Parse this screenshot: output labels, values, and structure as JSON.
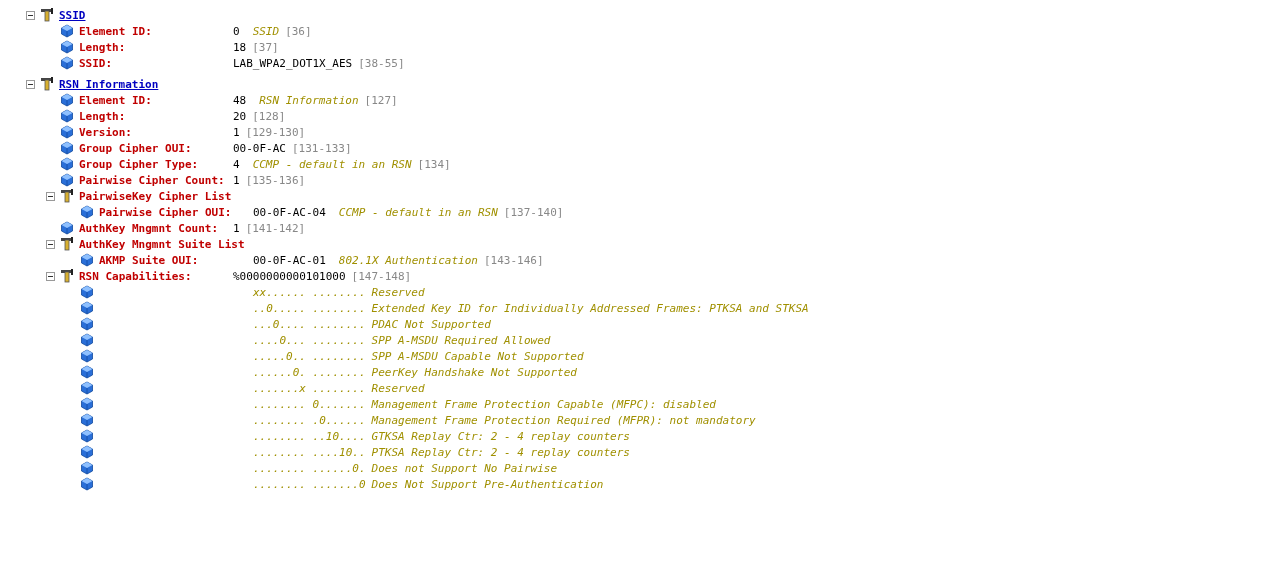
{
  "tree": [
    {
      "kind": "section",
      "title": "SSID",
      "expanded": true,
      "children": [
        {
          "kind": "field",
          "label": "Element ID:",
          "value": "0",
          "note": "SSID",
          "range": "[36]"
        },
        {
          "kind": "field",
          "label": "Length:",
          "value": "18",
          "range": "[37]"
        },
        {
          "kind": "field",
          "label": "SSID:",
          "value": "LAB_WPA2_DOT1X_AES",
          "range": "[38-55]"
        }
      ]
    },
    {
      "kind": "section",
      "title": "RSN Information",
      "expanded": true,
      "children": [
        {
          "kind": "field",
          "label": "Element ID:",
          "value": "48",
          "note": "RSN Information",
          "range": "[127]"
        },
        {
          "kind": "field",
          "label": "Length:",
          "value": "20",
          "range": "[128]"
        },
        {
          "kind": "field",
          "label": "Version:",
          "value": "1",
          "range": "[129-130]"
        },
        {
          "kind": "field",
          "label": "Group Cipher OUI:",
          "value": "00-0F-AC",
          "range": "[131-133]"
        },
        {
          "kind": "field",
          "label": "Group Cipher Type:",
          "value": "4",
          "note": "CCMP - default in an RSN",
          "range": "[134]"
        },
        {
          "kind": "field",
          "label": "Pairwise Cipher Count:",
          "value": "1",
          "range": "[135-136]"
        },
        {
          "kind": "group",
          "label": "PairwiseKey Cipher List",
          "expanded": true,
          "children": [
            {
              "kind": "field",
              "label": "Pairwise Cipher OUI:",
              "value": "00-0F-AC-04",
              "note": "CCMP - default in an RSN",
              "range": "[137-140]"
            }
          ]
        },
        {
          "kind": "field",
          "label": "AuthKey Mngmnt Count:",
          "value": "1",
          "range": "[141-142]"
        },
        {
          "kind": "group",
          "label": "AuthKey Mngmnt Suite List",
          "expanded": true,
          "children": [
            {
              "kind": "field",
              "label": "AKMP Suite OUI:",
              "value": "00-0F-AC-01",
              "note": "802.1X Authentication",
              "range": "[143-146]"
            }
          ]
        },
        {
          "kind": "group",
          "label": "RSN Capabilities:",
          "value": "%0000000000101000",
          "range": "[147-148]",
          "expanded": true,
          "children": [
            {
              "kind": "bits",
              "value": "xx...... ........",
              "note": "Reserved"
            },
            {
              "kind": "bits",
              "value": "..0..... ........",
              "note": "Extended Key ID for Individually Addressed Frames: PTKSA and STKSA"
            },
            {
              "kind": "bits",
              "value": "...0.... ........",
              "note": "PDAC Not Supported"
            },
            {
              "kind": "bits",
              "value": "....0... ........",
              "note": "SPP A-MSDU Required Allowed"
            },
            {
              "kind": "bits",
              "value": ".....0.. ........",
              "note": "SPP A-MSDU Capable Not Supported"
            },
            {
              "kind": "bits",
              "value": "......0. ........",
              "note": "PeerKey Handshake Not Supported"
            },
            {
              "kind": "bits",
              "value": ".......x ........",
              "note": "Reserved"
            },
            {
              "kind": "bits",
              "value": "........ 0.......",
              "note": "Management Frame Protection Capable (MFPC): disabled"
            },
            {
              "kind": "bits",
              "value": "........ .0......",
              "note": "Management Frame Protection Required (MFPR): not mandatory"
            },
            {
              "kind": "bits",
              "value": "........ ..10....",
              "note": "GTKSA Replay Ctr: 2 - 4 replay counters"
            },
            {
              "kind": "bits",
              "value": "........ ....10..",
              "note": "PTKSA Replay Ctr: 2 - 4 replay counters"
            },
            {
              "kind": "bits",
              "value": "........ ......0.",
              "note": "Does not Support No Pairwise"
            },
            {
              "kind": "bits",
              "value": "........ .......0",
              "note": "Does Not Support Pre-Authentication"
            }
          ]
        }
      ]
    }
  ]
}
